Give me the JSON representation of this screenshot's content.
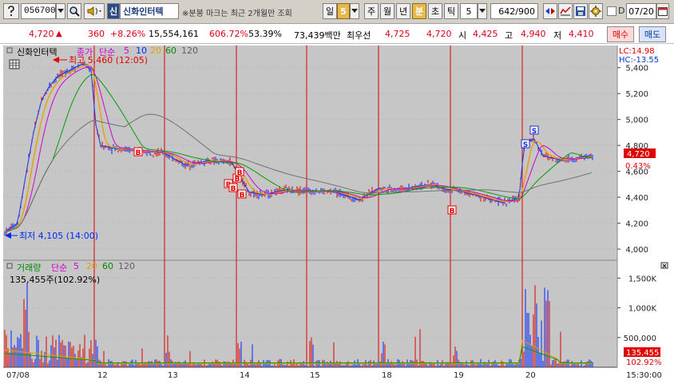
{
  "toolbar": {
    "stock_code": "056700",
    "market_badge": "신",
    "stock_name": "신화인터텍",
    "notice": "※분봉 마크는 최근 2개월만 조회",
    "period_buttons": [
      "일",
      "5",
      "주",
      "월",
      "년",
      "분",
      "초",
      "틱"
    ],
    "active_period": "분",
    "interval_value": "5",
    "count_display": "642/900",
    "checkbox_label": "D",
    "date_value": "07/20"
  },
  "quote": {
    "price": "4,720",
    "change_arrow": "▲",
    "change": "360",
    "change_rate": "+8.26%",
    "volume": "15,554,161",
    "volume_rate": "606.72%",
    "turnover_rate": "53.39%",
    "amount": "73,439백만",
    "best_bid_label": "최우선",
    "ask_price": "4,725",
    "bid_price": "4,720",
    "open_label": "시",
    "open": "4,425",
    "high_label": "고",
    "high": "4,940",
    "low_label": "저",
    "low": "4,410",
    "buy_label": "매수",
    "sell_label": "매도"
  },
  "colors": {
    "chart_bg": "#c6c6c6",
    "ma5": "#e8a000",
    "ma10": "#d000d0",
    "ma20": "#00a000",
    "ma60": "#707070",
    "price_line": "#2030e0",
    "up": "#e00000",
    "down": "#0028ff",
    "vline": "#e00000"
  },
  "price_panel": {
    "legend": {
      "name": "신화인터텍",
      "series": "종가",
      "ma_type": "단순",
      "ma_periods": [
        "5",
        "10",
        "20",
        "60",
        "120"
      ]
    },
    "high_marker": "최고 5,460 (12:05)",
    "low_marker": "최저 4,105 (14:00)",
    "lc": "LC:14.98",
    "hc": "HC:-13.55",
    "current_price": "4,720",
    "current_rate": "0.43%",
    "y_ticks": [
      "5,400",
      "5,200",
      "5,000",
      "4,800",
      "4,600",
      "4,400",
      "4,200",
      "4,000"
    ]
  },
  "volume_panel": {
    "legend": {
      "name": "거래량",
      "ma_type": "단순",
      "ma_periods": [
        "5",
        "20",
        "60",
        "120"
      ]
    },
    "current_volume": "135,455주(102.92%)",
    "current_value": "135,455",
    "current_rate": "102.92%",
    "y_ticks": [
      "1,500K",
      "1,000K",
      "500,000"
    ]
  },
  "x_axis": {
    "dates": [
      "07/08",
      "12",
      "13",
      "14",
      "15",
      "18",
      "19",
      "20"
    ],
    "end_time": "15:30:00"
  },
  "signals": {
    "buy_label": "B",
    "sell_label": "S"
  },
  "chart_data": {
    "type": "line",
    "title": "신화인터텍",
    "categories": [
      "07/08",
      "12",
      "13",
      "14",
      "15",
      "18",
      "19",
      "20"
    ],
    "ylim": [
      4000,
      5460
    ],
    "series": [
      {
        "name": "종가",
        "values": [
          4105,
          4560,
          4660,
          4530,
          4420,
          4480,
          4350,
          4720
        ]
      }
    ],
    "volume_ylim": [
      0,
      1800000
    ],
    "price_high": 5460,
    "price_low": 4105
  }
}
